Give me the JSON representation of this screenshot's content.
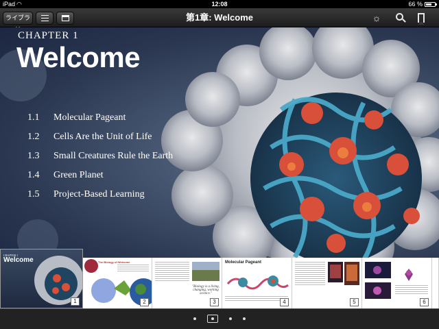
{
  "status_bar": {
    "carrier": "iPad",
    "time": "12:08",
    "battery_percent": "66 %",
    "battery_level": 0.66
  },
  "toolbar": {
    "library_label": "ライブラリ",
    "toc_icon": "list-icon",
    "notes_icon": "notes-icon",
    "title": "第1章: Welcome",
    "brightness_icon": "brightness-icon",
    "search_icon": "search-icon",
    "bookmark_icon": "bookmark-icon"
  },
  "chapter": {
    "label": "CHAPTER 1",
    "title": "Welcome",
    "sections": [
      {
        "num": "1.1",
        "name": "Molecular Pageant"
      },
      {
        "num": "1.2",
        "name": "Cells Are the Unit of Life"
      },
      {
        "num": "1.3",
        "name": "Small Creatures Rule the Earth"
      },
      {
        "num": "1.4",
        "name": "Green Planet"
      },
      {
        "num": "1.5",
        "name": "Project-Based Learning"
      }
    ]
  },
  "thumbnails": [
    {
      "page": "1",
      "mini_chapter": "CHAPTER 1",
      "mini_title": "Welcome"
    },
    {
      "page": "2",
      "heading": "The Biology of Welcome"
    },
    {
      "page": "3",
      "quote": "\"Biology is a living, changing, working science.\""
    },
    {
      "page": "4",
      "heading": "Molecular Pageant"
    },
    {
      "page": "5",
      "heading": ""
    },
    {
      "page": "6",
      "heading": ""
    }
  ],
  "pager": {
    "dot_count": 4,
    "current_index": 1
  },
  "colors": {
    "toolbar_bg": "#2a2a2a",
    "hero_bg": "#3a4a64",
    "thumb_heading": "#b0362a"
  }
}
